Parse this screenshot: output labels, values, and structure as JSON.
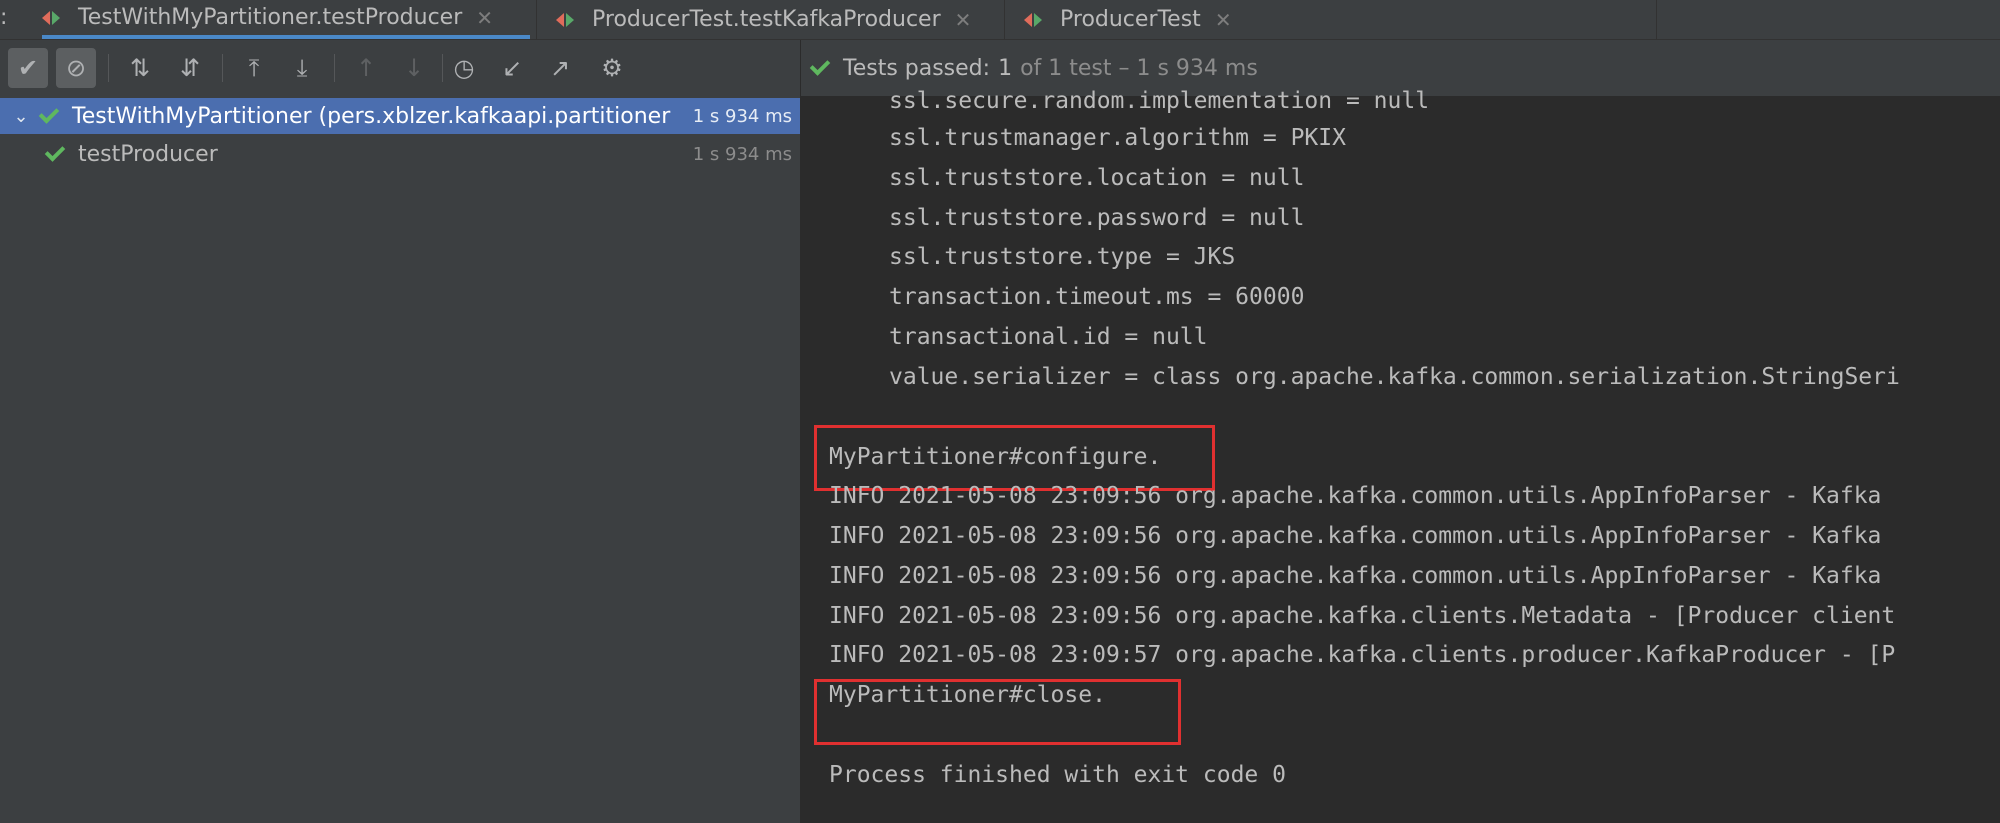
{
  "tabs": [
    {
      "label": "TestWithMyPartitioner.testProducer",
      "active": true
    },
    {
      "label": "ProducerTest.testKafkaProducer",
      "active": false
    },
    {
      "label": "ProducerTest",
      "active": false
    }
  ],
  "tab_close_glyph": "✕",
  "toolbar": {
    "buttons": [
      {
        "name": "show-passed-button",
        "icon": "check-icon",
        "glyph": "✔"
      },
      {
        "name": "show-ignored-button",
        "icon": "ignored-icon",
        "glyph": "⊘"
      },
      {
        "name": "sort-alphabetically-button",
        "icon": "sort-alpha-icon",
        "glyph": "⇅"
      },
      {
        "name": "sort-by-duration-button",
        "icon": "sort-duration-icon",
        "glyph": "⇵"
      },
      {
        "name": "expand-all-button",
        "icon": "expand-all-icon",
        "glyph": "⤒"
      },
      {
        "name": "collapse-all-button",
        "icon": "collapse-all-icon",
        "glyph": "⤓"
      },
      {
        "name": "previous-failed-button",
        "icon": "arrow-up-icon",
        "glyph": "↑"
      },
      {
        "name": "next-failed-button",
        "icon": "arrow-down-icon",
        "glyph": "↓"
      },
      {
        "name": "test-history-button",
        "icon": "history-icon",
        "glyph": "◷"
      },
      {
        "name": "import-tests-button",
        "icon": "import-icon",
        "glyph": "↙"
      },
      {
        "name": "export-tests-button",
        "icon": "export-icon",
        "glyph": "↗"
      },
      {
        "name": "settings-button",
        "icon": "gear-icon",
        "glyph": "⚙"
      }
    ]
  },
  "tree": {
    "root": {
      "label": "TestWithMyPartitioner (pers.xblzer.kafkaapi.partitioner",
      "time": "1 s 934 ms"
    },
    "child": {
      "label": "testProducer",
      "time": "1 s 934 ms"
    }
  },
  "status": {
    "passed_label": "Tests passed:",
    "passed_count": "1",
    "detail": "of 1 test – 1 s 934 ms"
  },
  "console": {
    "config_lines": [
      "ssl.secure.random.implementation = null",
      "ssl.trustmanager.algorithm = PKIX",
      "ssl.truststore.location = null",
      "ssl.truststore.password = null",
      "ssl.truststore.type = JKS",
      "transaction.timeout.ms = 60000",
      "transactional.id = null",
      "value.serializer = class org.apache.kafka.common.serialization.StringSeri"
    ],
    "configure_line": "MyPartitioner#configure.",
    "info_lines": [
      "INFO 2021-05-08 23:09:56 org.apache.kafka.common.utils.AppInfoParser - Kafka",
      "INFO 2021-05-08 23:09:56 org.apache.kafka.common.utils.AppInfoParser - Kafka",
      "INFO 2021-05-08 23:09:56 org.apache.kafka.common.utils.AppInfoParser - Kafka",
      "INFO 2021-05-08 23:09:56 org.apache.kafka.clients.Metadata - [Producer client",
      "INFO 2021-05-08 23:09:57 org.apache.kafka.clients.producer.KafkaProducer - [P"
    ],
    "close_line": "MyPartitioner#close.",
    "exit_line": "Process finished with exit code 0"
  },
  "colors": {
    "highlight_box": "#e03030",
    "selection": "#4b6eaf",
    "pass_check": "#5fb85f"
  }
}
